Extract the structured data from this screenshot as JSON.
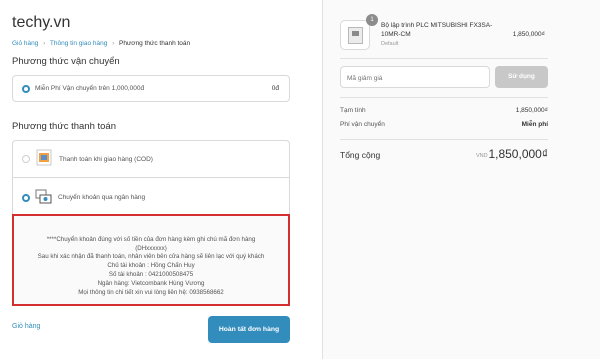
{
  "store": {
    "name": "techy.vn"
  },
  "breadcrumb": {
    "cart": "Giỏ hàng",
    "shipping_info": "Thông tin giao hàng",
    "current": "Phương thức thanh toán",
    "sep": "›"
  },
  "shipping": {
    "title": "Phương thức vận chuyển",
    "option_label": "Miễn Phí Vận chuyển trên 1,000,000đ",
    "option_price": "0đ",
    "selected": true
  },
  "payment": {
    "title": "Phương thức thanh toán",
    "methods": [
      {
        "label": "Thanh toán khi giao hàng (COD)",
        "selected": false,
        "icon": "cod-icon"
      },
      {
        "label": "Chuyển khoản qua ngân hàng",
        "selected": true,
        "icon": "bank-transfer-icon"
      }
    ],
    "bank_info": [
      "****Chuyển khoản đúng với số tiền của đơn hàng kèm ghi chú mã đơn hàng",
      "(DHxxxxxx)",
      "Sau khi xác nhận đã thanh toán, nhân viên bên cửa hàng sẽ liên lạc với quý khách",
      "Chủ tài khoản : Hồng Chấn Huy",
      "Số tài khoản : 0421000508475",
      "Ngân hàng: Vietcombank Hùng Vương",
      "Mọi thông tin chi tiết xin vui lòng liên hệ: 0938568662"
    ]
  },
  "footer": {
    "back_link": "Giỏ hàng",
    "finish_button": "Hoàn tất đơn hàng"
  },
  "order": {
    "item": {
      "name": "Bộ lập trình PLC MITSUBISHI FX3SA-10MR-CM",
      "variant": "Default",
      "quantity": "1",
      "price": "1,850,000₫"
    },
    "coupon": {
      "placeholder": "Mã giảm giá",
      "button": "Sử dụng"
    },
    "subtotal_label": "Tạm tính",
    "subtotal_value": "1,850,000₫",
    "shipping_label": "Phí vận chuyển",
    "shipping_value": "Miễn phí",
    "total_label": "Tổng cộng",
    "currency": "VND",
    "total_value": "1,850,000₫"
  },
  "colors": {
    "accent": "#338dbc",
    "highlight_border": "#d32f2f",
    "sidebar_bg": "#fafafa"
  }
}
